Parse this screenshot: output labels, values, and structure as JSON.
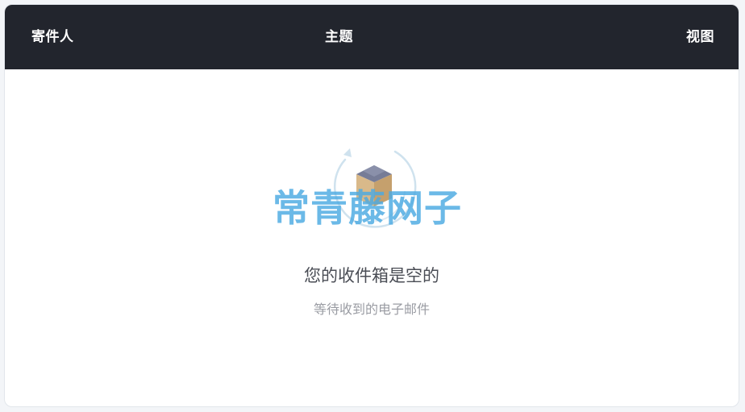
{
  "table_header": {
    "sender": "寄件人",
    "subject": "主题",
    "view": "视图"
  },
  "empty_state": {
    "title": "您的收件箱是空的",
    "subtitle": "等待收到的电子邮件",
    "icon": "empty-inbox-box-icon"
  },
  "watermark": {
    "text": "常青藤网子"
  },
  "colors": {
    "header_bg": "#22252d",
    "header_text": "#ffffff",
    "watermark": "#4aaae2"
  }
}
